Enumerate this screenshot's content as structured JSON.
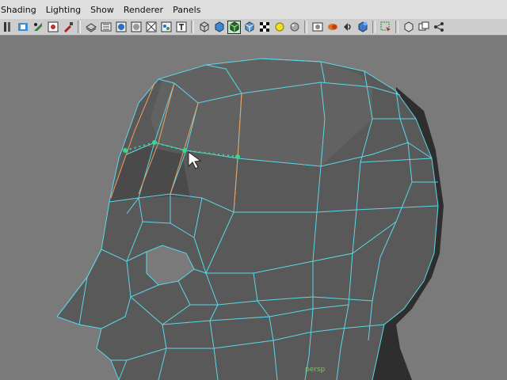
{
  "menubar": {
    "items": [
      "Shading",
      "Lighting",
      "Show",
      "Renderer",
      "Panels"
    ]
  },
  "toolbar": {
    "groups": [
      [
        "grid-lines-icon",
        "bookmark-icon",
        "camera-attributes-icon",
        "camera-settings-icon"
      ],
      [
        "wireframe-icon",
        "film-gate-icon",
        "smooth-shade-icon",
        "flat-shade-icon",
        "xray-icon",
        "shadows-icon",
        "text-icon"
      ],
      [
        "wireframe-cube-icon",
        "smooth-cube-icon",
        "wire-on-shaded-icon",
        "textured-cube-icon",
        "checker-icon",
        "default-light-icon",
        "sphere-icon"
      ],
      [
        "use-lights-icon",
        "shadow-maps-icon",
        "high-quality-icon",
        "isolate-icon"
      ],
      [
        "select-camera-icon"
      ],
      [
        "single-view-icon",
        "two-panes-icon",
        "hypergraph-icon"
      ]
    ],
    "active_button": "wire-on-shaded-icon"
  },
  "viewport": {
    "camera_label": "persp",
    "wire_color": "#5ad8ea",
    "selected_edge_color": "#f0a060",
    "split_tool_color": "#3ad88a"
  }
}
